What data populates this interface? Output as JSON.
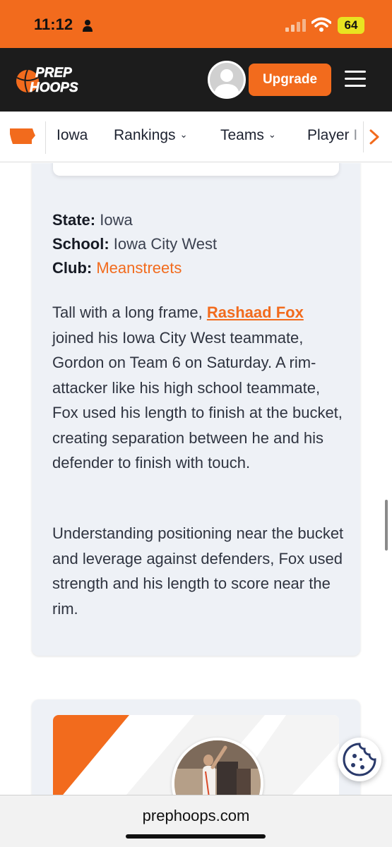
{
  "status_bar": {
    "time": "11:12",
    "battery": "64",
    "background": "#f26b1d"
  },
  "header": {
    "logo_line1": "PREP",
    "logo_line2": "HOOPS",
    "upgrade_label": "Upgrade",
    "avatar_icon": "user-avatar-icon",
    "menu_icon": "hamburger-menu-icon"
  },
  "nav": {
    "state_icon": "iowa-state-icon",
    "items": [
      {
        "label": "Iowa"
      },
      {
        "label": "Rankings"
      },
      {
        "label": "Teams"
      },
      {
        "label": "Player I"
      }
    ],
    "next_icon": "chevron-right-icon"
  },
  "article": {
    "state_label": "State:",
    "state_value": "Iowa",
    "school_label": "School:",
    "school_value": "Iowa City West",
    "club_label": "Club:",
    "club_value": "Meanstreets",
    "para1_intro": "Tall with a long frame, ",
    "player_name": "Rashaad Fox",
    "para1_rest": " joined his Iowa City West teammate, Gordon on Team 6 on Saturday. A rim-attacker like his high school teammate, Fox used his length to finish at the bucket, creating separation between he and his defender to finish with touch.",
    "para2": "Understanding positioning near the bucket and leverage against defenders, Fox used strength and his length to score near the rim."
  },
  "browser": {
    "url": "prephoops.com"
  },
  "colors": {
    "accent": "#f26b1d",
    "header_bg": "#1c1c1c",
    "card_bg": "#eef1f6"
  }
}
